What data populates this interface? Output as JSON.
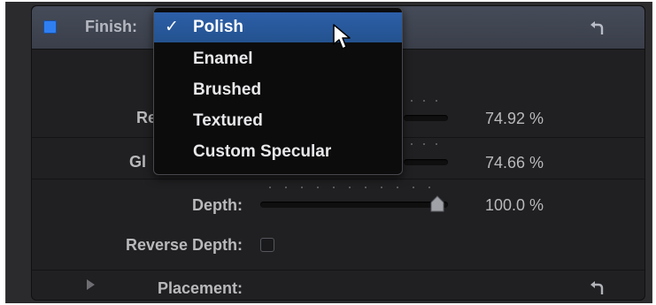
{
  "finish": {
    "label": "Finish:",
    "enabled": true
  },
  "menu": {
    "items": [
      {
        "label": "Polish",
        "selected": true,
        "check": "✓"
      },
      {
        "label": "Enamel",
        "selected": false,
        "check": ""
      },
      {
        "label": "Brushed",
        "selected": false,
        "check": ""
      },
      {
        "label": "Textured",
        "selected": false,
        "check": ""
      },
      {
        "label": "Custom Specular",
        "selected": false,
        "check": ""
      }
    ]
  },
  "params": {
    "reflectivity": {
      "label_visible": "Re",
      "value": "74.92 %"
    },
    "gloss": {
      "label_visible": "Gl",
      "value": "74.66 %"
    },
    "depth": {
      "label": "Depth:",
      "value": "100.0 %",
      "level": 1.0
    },
    "reverse_depth": {
      "label": "Reverse Depth:",
      "checked": false
    },
    "placement": {
      "label": "Placement:"
    }
  },
  "icons": {
    "reset": "reset-arrow-icon",
    "disclosure": "disclosure-triangle-icon",
    "cursor": "mouse-pointer-icon"
  },
  "colors": {
    "accent": "#2f7ff2",
    "menu_highlight": "#2c5fa8",
    "panel": "#202022",
    "header": "#454b58"
  }
}
